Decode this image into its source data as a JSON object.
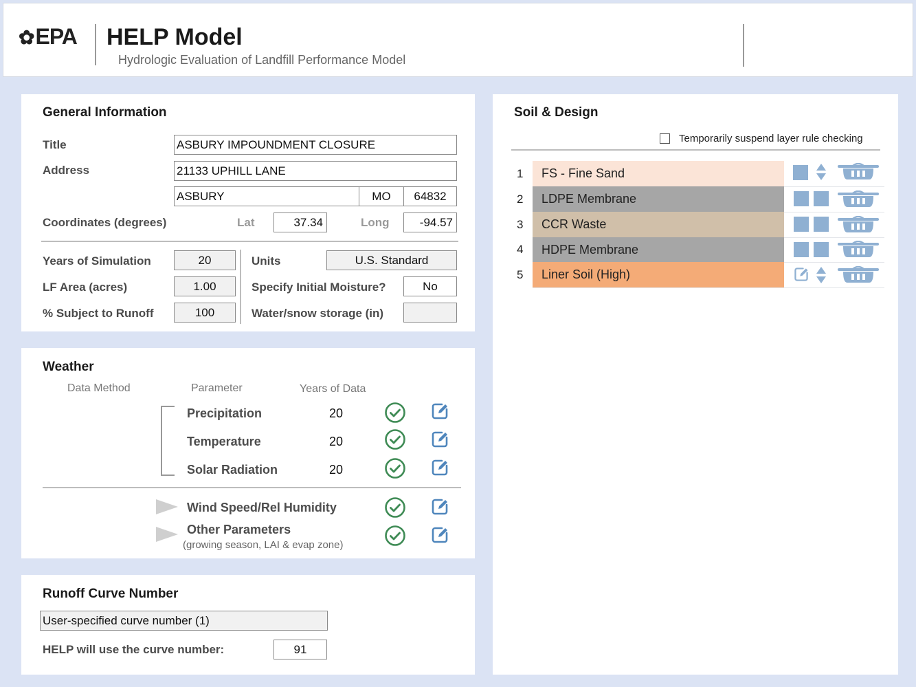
{
  "header": {
    "logo_text": "EPA",
    "title": "HELP Model",
    "subtitle": "Hydrologic Evaluation of Landfill Performance Model"
  },
  "general": {
    "heading": "General Information",
    "title_label": "Title",
    "title_value": "ASBURY IMPOUNDMENT CLOSURE",
    "address_label": "Address",
    "address_line1": "21133 UPHILL LANE",
    "city": "ASBURY",
    "state": "MO",
    "zip": "64832",
    "coords_label": "Coordinates (degrees)",
    "lat_label": "Lat",
    "lat_value": "37.34",
    "long_label": "Long",
    "long_value": "-94.57",
    "years_label": "Years of Simulation",
    "years_value": "20",
    "area_label": "LF Area (acres)",
    "area_value": "1.00",
    "runoff_label": "% Subject to Runoff",
    "runoff_value": "100",
    "units_label": "Units",
    "units_value": "U.S. Standard",
    "moisture_label": "Specify Initial Moisture?",
    "moisture_value": "No",
    "snow_label": "Water/snow storage (in)",
    "snow_value": ""
  },
  "weather": {
    "heading": "Weather",
    "col_method": "Data Method",
    "col_param": "Parameter",
    "col_years": "Years of Data",
    "rows": [
      {
        "name": "Precipitation",
        "years": "20"
      },
      {
        "name": "Temperature",
        "years": "20"
      },
      {
        "name": "Solar Radiation",
        "years": "20"
      }
    ],
    "wind": "Wind Speed/Rel Humidity",
    "other": "Other Parameters",
    "other_note": "(growing season, LAI & evap zone)"
  },
  "runoff": {
    "heading": "Runoff Curve Number",
    "method": "User-specified curve number (1)",
    "use_label": "HELP will use the curve number:",
    "value": "91"
  },
  "soil": {
    "heading": "Soil & Design",
    "suspend_label": "Temporarily suspend layer rule checking",
    "layers": [
      {
        "num": "1",
        "name": "FS - Fine Sand",
        "color": "#fbe4d7"
      },
      {
        "num": "2",
        "name": "LDPE Membrane",
        "color": "#a6a6a6"
      },
      {
        "num": "3",
        "name": "CCR Waste",
        "color": "#d0bfa9"
      },
      {
        "num": "4",
        "name": "HDPE Membrane",
        "color": "#a6a6a6"
      },
      {
        "num": "5",
        "name": "Liner Soil (High)",
        "color": "#f4ab77"
      }
    ]
  },
  "colors": {
    "check_green": "#3f8b55",
    "edit_blue": "#4f86bc",
    "layer_icon_blue": "#8fb0d2"
  },
  "icons": [
    "epa-logo-icon",
    "check-circle-icon",
    "edit-icon",
    "expand-triangle-icon",
    "sort-arrows-icon",
    "delete-layer-icon"
  ]
}
